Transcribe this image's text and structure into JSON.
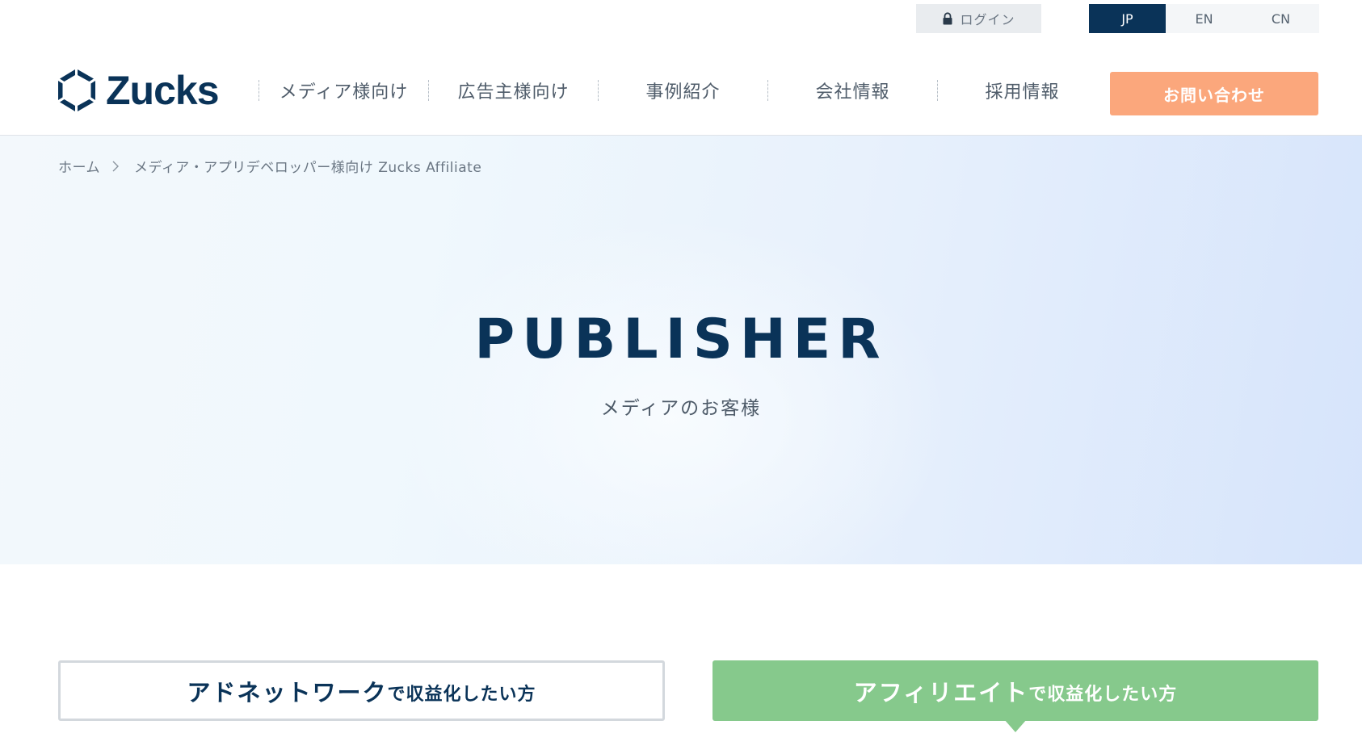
{
  "topbar": {
    "login_label": "ログイン",
    "languages": [
      {
        "code": "JP",
        "active": true
      },
      {
        "code": "EN",
        "active": false
      },
      {
        "code": "CN",
        "active": false
      }
    ]
  },
  "header": {
    "logo_text": "Zucks",
    "nav": [
      {
        "label": "メディア様向け"
      },
      {
        "label": "広告主様向け"
      },
      {
        "label": "事例紹介"
      },
      {
        "label": "会社情報"
      },
      {
        "label": "採用情報"
      }
    ],
    "contact_label": "お問い合わせ"
  },
  "breadcrumb": {
    "home": "ホーム",
    "current": "メディア・アプリデベロッパー様向け Zucks Affiliate"
  },
  "hero": {
    "title": "PUBLISHER",
    "subtitle": "メディアのお客様"
  },
  "tabs": {
    "adnetwork": {
      "strong": "アドネットワーク",
      "small": "で収益化したい方"
    },
    "affiliate": {
      "strong": "アフィリエイト",
      "small": "で収益化したい方"
    }
  },
  "colors": {
    "brand_navy": "#0a3358",
    "contact_orange": "#fba77c",
    "affiliate_green": "#86c98c",
    "icons": [
      "lock-icon",
      "zucks-logo-icon",
      "chevron-right-icon"
    ]
  }
}
